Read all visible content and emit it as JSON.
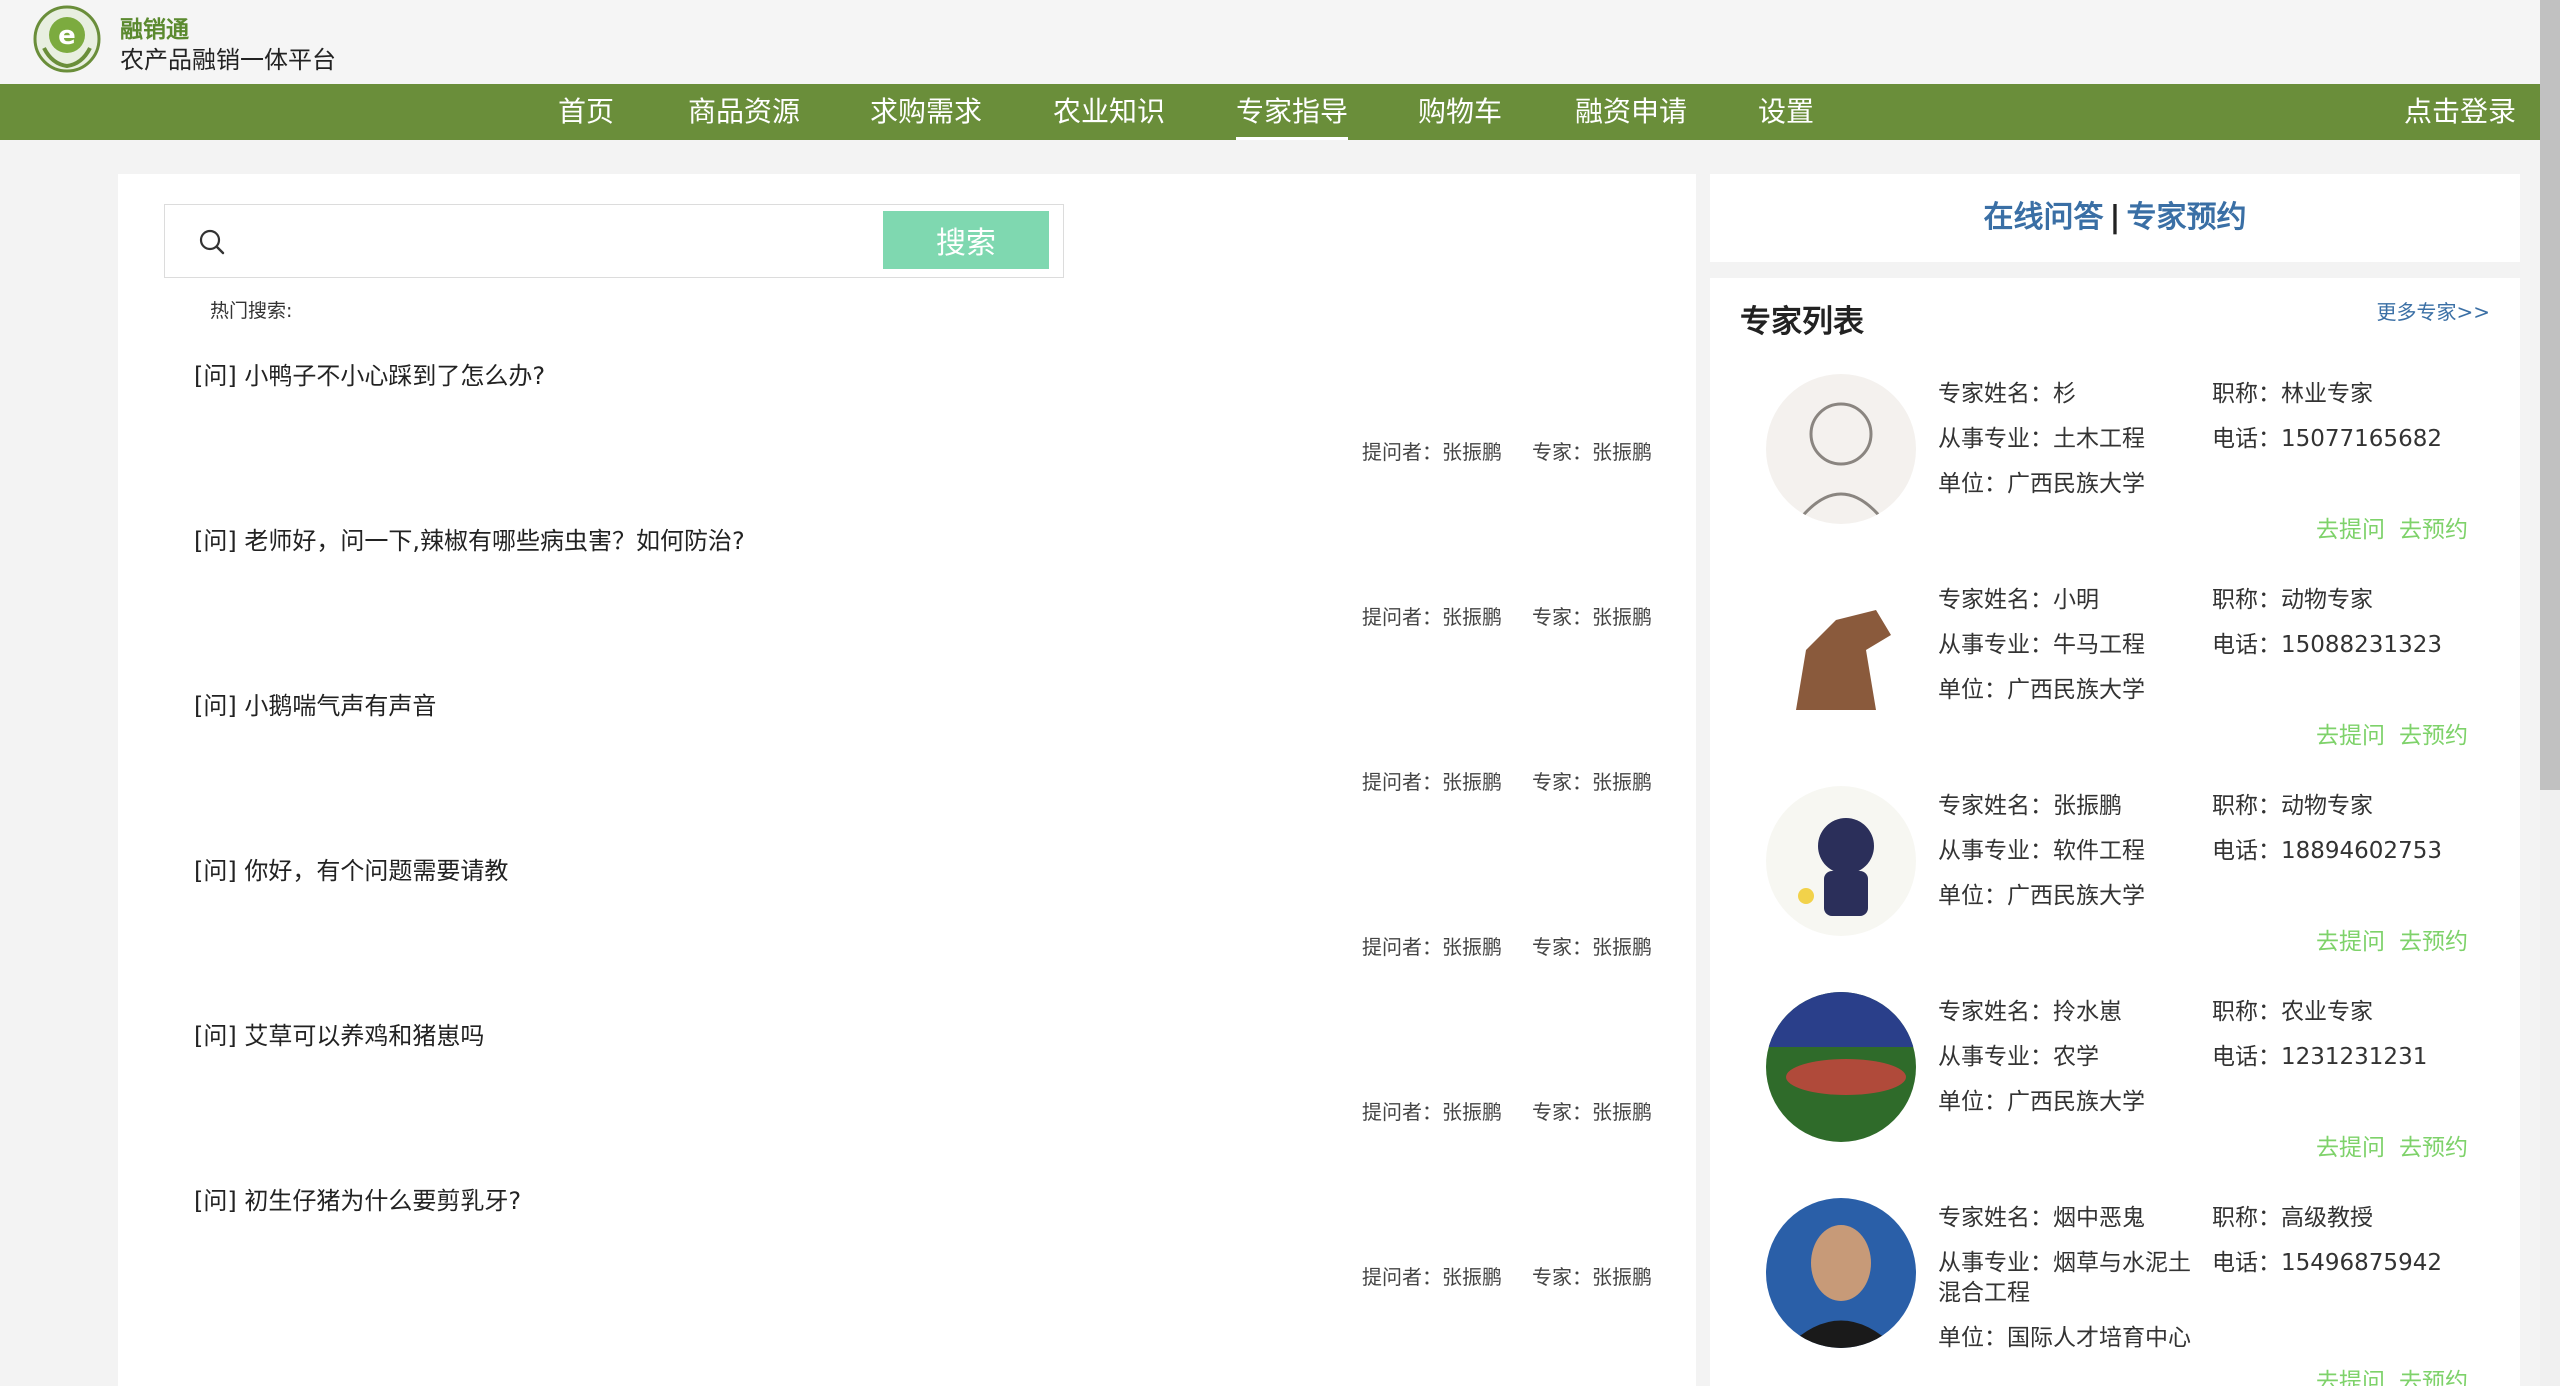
{
  "header": {
    "brand_name": "融销通",
    "brand_sub": "农产品融销一体平台"
  },
  "nav": {
    "items": [
      "首页",
      "商品资源",
      "求购需求",
      "农业知识",
      "专家指导",
      "购物车",
      "融资申请",
      "设置"
    ],
    "active": "专家指导",
    "login": "点击登录"
  },
  "search": {
    "placeholder": "",
    "button": "搜索",
    "hot_label": "热门搜索:"
  },
  "questions": [
    {
      "q": "[问] 小鸭子不小心踩到了怎么办?",
      "asker": "提问者：张振鹏",
      "expert": "专家：张振鹏"
    },
    {
      "q": "[问] 老师好，问一下,辣椒有哪些病虫害？如何防治?",
      "asker": "提问者：张振鹏",
      "expert": "专家：张振鹏"
    },
    {
      "q": "[问] 小鹅喘气声有声音",
      "asker": "提问者：张振鹏",
      "expert": "专家：张振鹏"
    },
    {
      "q": "[问] 你好，有个问题需要请教",
      "asker": "提问者：张振鹏",
      "expert": "专家：张振鹏"
    },
    {
      "q": "[问] 艾草可以养鸡和猪崽吗",
      "asker": "提问者：张振鹏",
      "expert": "专家：张振鹏"
    },
    {
      "q": "[问] 初生仔猪为什么要剪乳牙?",
      "asker": "提问者：张振鹏",
      "expert": "专家：张振鹏"
    }
  ],
  "tabs": {
    "online": "在线问答",
    "separator": "|",
    "booking": "专家预约"
  },
  "experts_panel": {
    "title": "专家列表",
    "more": "更多专家>>",
    "ask_label": "去提问",
    "book_label": "去预约"
  },
  "experts": [
    {
      "name": "专家姓名：杉",
      "title": "职称：林业专家",
      "major": "从事专业：土木工程",
      "major2": "",
      "phone": "电话：15077165682",
      "unit": "单位：广西民族大学",
      "avatar_bg": "#f4f1ee",
      "avatar_fg": "#8a8580"
    },
    {
      "name": "专家姓名：小明",
      "title": "职称：动物专家",
      "major": "从事专业：牛马工程",
      "major2": "",
      "phone": "电话：15088231323",
      "unit": "单位：广西民族大学",
      "avatar_bg": "#ffffff",
      "avatar_fg": "#8a5a3c"
    },
    {
      "name": "专家姓名：张振鹏",
      "title": "职称：动物专家",
      "major": "从事专业：软件工程",
      "major2": "",
      "phone": "电话：18894602753",
      "unit": "单位：广西民族大学",
      "avatar_bg": "#f7f7f2",
      "avatar_fg": "#2b2f5a"
    },
    {
      "name": "专家姓名：拎水崽",
      "title": "职称：农业专家",
      "major": "从事专业：农学",
      "major2": "",
      "phone": "电话：1231231231",
      "unit": "单位：广西民族大学",
      "avatar_bg": "#2f6b2a",
      "avatar_fg": "#b04a3a"
    },
    {
      "name": "专家姓名：烟中恶鬼",
      "title": "职称：高级教授",
      "major": "从事专业：烟草与水泥土",
      "major2": "混合工程",
      "phone": "电话：15496875942",
      "unit": "单位：国际人才培育中心",
      "avatar_bg": "#2a5fa8",
      "avatar_fg": "#c79a78"
    }
  ]
}
